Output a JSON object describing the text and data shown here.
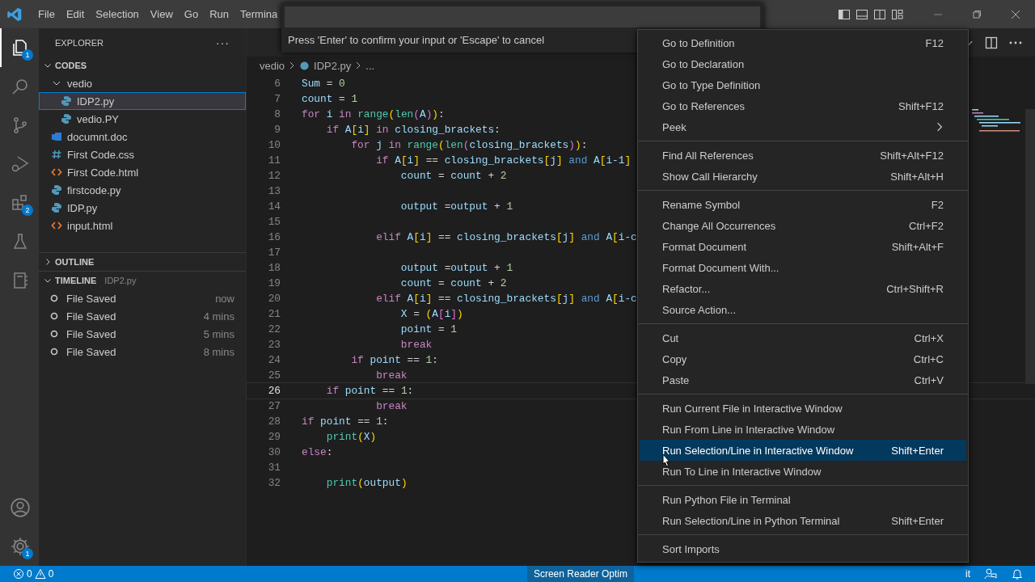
{
  "menu_bar": [
    "File",
    "Edit",
    "Selection",
    "View",
    "Go",
    "Run",
    "Termina"
  ],
  "activity_bar": [
    {
      "kind": "explorer",
      "badge": "1",
      "selected": true
    },
    {
      "kind": "search",
      "selected": false
    },
    {
      "kind": "source-control",
      "selected": false
    },
    {
      "kind": "run-debug",
      "selected": false
    },
    {
      "kind": "extensions",
      "badge": "2",
      "selected": false
    },
    {
      "kind": "testing",
      "selected": false
    },
    {
      "kind": "notebook",
      "selected": false
    }
  ],
  "activity_bottom": [
    {
      "kind": "account"
    },
    {
      "kind": "manage",
      "badge": "1"
    }
  ],
  "sidebar": {
    "title": "EXPLORER",
    "more": "···",
    "folder": "CODES",
    "tree": [
      {
        "name": "vedio",
        "kind": "folder",
        "expanded": true,
        "children": [
          {
            "name": "IDP2.py",
            "kind": "python",
            "selected": true
          },
          {
            "name": "vedio.PY",
            "kind": "python",
            "selected": false
          }
        ]
      },
      {
        "name": "documnt.doc",
        "kind": "doc",
        "selected": false
      },
      {
        "name": "First Code.css",
        "kind": "css",
        "selected": false
      },
      {
        "name": "First Code.html",
        "kind": "html",
        "selected": false
      },
      {
        "name": "firstcode.py",
        "kind": "python",
        "selected": false
      },
      {
        "name": "IDP.py",
        "kind": "python",
        "selected": false
      },
      {
        "name": "input.html",
        "kind": "html",
        "selected": false
      }
    ],
    "outline": {
      "title": "OUTLINE",
      "expanded": false
    },
    "timeline": {
      "title": "TIMELINE",
      "file": "IDP2.py",
      "expanded": true,
      "items": [
        {
          "label": "File Saved",
          "time": "now"
        },
        {
          "label": "File Saved",
          "time": "4 mins"
        },
        {
          "label": "File Saved",
          "time": "5 mins"
        },
        {
          "label": "File Saved",
          "time": "8 mins"
        }
      ]
    }
  },
  "command_palette": {
    "message": "Press 'Enter' to confirm your input or 'Escape' to cancel"
  },
  "breadcrumb": [
    "vedio",
    "IDP2.py",
    "..."
  ],
  "editor": {
    "lines": [
      {
        "n": "6",
        "current": false,
        "tokens": [
          {
            "text": "Sum",
            "kind": "var"
          },
          {
            "text": " = ",
            "kind": "op"
          },
          {
            "text": "0",
            "kind": "num"
          }
        ]
      },
      {
        "n": "7",
        "current": false,
        "tokens": [
          {
            "text": "count",
            "kind": "var"
          },
          {
            "text": " = ",
            "kind": "op"
          },
          {
            "text": "1",
            "kind": "num"
          }
        ]
      },
      {
        "n": "8",
        "current": false,
        "tokens": [
          {
            "text": "for ",
            "kind": "kw"
          },
          {
            "text": "i ",
            "kind": "var"
          },
          {
            "text": "in ",
            "kind": "kw"
          },
          {
            "text": "range",
            "kind": "fn"
          },
          {
            "text": "(",
            "kind": "b1"
          },
          {
            "text": "len",
            "kind": "fn"
          },
          {
            "text": "(",
            "kind": "b2"
          },
          {
            "text": "A",
            "kind": "var"
          },
          {
            "text": ")",
            "kind": "b2"
          },
          {
            "text": ")",
            "kind": "b1"
          },
          {
            "text": ":",
            "kind": "op"
          }
        ]
      },
      {
        "n": "9",
        "current": false,
        "tokens": [
          {
            "text": "    if ",
            "kind": "kw"
          },
          {
            "text": "A",
            "kind": "var"
          },
          {
            "text": "[",
            "kind": "b1"
          },
          {
            "text": "i",
            "kind": "var"
          },
          {
            "text": "]",
            "kind": "b1"
          },
          {
            "text": " in ",
            "kind": "kw"
          },
          {
            "text": "closing_brackets",
            "kind": "var"
          },
          {
            "text": ":",
            "kind": "op"
          }
        ]
      },
      {
        "n": "10",
        "current": false,
        "tokens": [
          {
            "text": "        for ",
            "kind": "kw"
          },
          {
            "text": "j ",
            "kind": "var"
          },
          {
            "text": "in ",
            "kind": "kw"
          },
          {
            "text": "range",
            "kind": "fn"
          },
          {
            "text": "(",
            "kind": "b1"
          },
          {
            "text": "len",
            "kind": "fn"
          },
          {
            "text": "(",
            "kind": "b2"
          },
          {
            "text": "closing_brackets",
            "kind": "var"
          },
          {
            "text": ")",
            "kind": "b2"
          },
          {
            "text": ")",
            "kind": "b1"
          },
          {
            "text": ":",
            "kind": "op"
          }
        ]
      },
      {
        "n": "11",
        "current": false,
        "tokens": [
          {
            "text": "            if ",
            "kind": "kw"
          },
          {
            "text": "A",
            "kind": "var"
          },
          {
            "text": "[",
            "kind": "b1"
          },
          {
            "text": "i",
            "kind": "var"
          },
          {
            "text": "]",
            "kind": "b1"
          },
          {
            "text": " == ",
            "kind": "op"
          },
          {
            "text": "closing_brackets",
            "kind": "var"
          },
          {
            "text": "[",
            "kind": "b1"
          },
          {
            "text": "j",
            "kind": "var"
          },
          {
            "text": "]",
            "kind": "b1"
          },
          {
            "text": " and ",
            "kind": "and"
          },
          {
            "text": "A",
            "kind": "var"
          },
          {
            "text": "[",
            "kind": "b1"
          },
          {
            "text": "i-1",
            "kind": "var"
          },
          {
            "text": "]",
            "kind": "b1"
          }
        ]
      },
      {
        "n": "12",
        "current": false,
        "tokens": [
          {
            "text": "                count",
            "kind": "var"
          },
          {
            "text": " = ",
            "kind": "op"
          },
          {
            "text": "count",
            "kind": "var"
          },
          {
            "text": " + ",
            "kind": "op"
          },
          {
            "text": "2",
            "kind": "num"
          }
        ]
      },
      {
        "n": "13",
        "current": false
      },
      {
        "n": "14",
        "current": false,
        "tokens": [
          {
            "text": "                output",
            "kind": "var"
          },
          {
            "text": " =",
            "kind": "op"
          },
          {
            "text": "output",
            "kind": "var"
          },
          {
            "text": " + ",
            "kind": "op"
          },
          {
            "text": "1",
            "kind": "num"
          }
        ]
      },
      {
        "n": "15",
        "current": false
      },
      {
        "n": "16",
        "current": false,
        "tokens": [
          {
            "text": "            elif ",
            "kind": "kw"
          },
          {
            "text": "A",
            "kind": "var"
          },
          {
            "text": "[",
            "kind": "b1"
          },
          {
            "text": "i",
            "kind": "var"
          },
          {
            "text": "]",
            "kind": "b1"
          },
          {
            "text": " == ",
            "kind": "op"
          },
          {
            "text": "closing_brackets",
            "kind": "var"
          },
          {
            "text": "[",
            "kind": "b1"
          },
          {
            "text": "j",
            "kind": "var"
          },
          {
            "text": "]",
            "kind": "b1"
          },
          {
            "text": " and ",
            "kind": "and"
          },
          {
            "text": "A",
            "kind": "var"
          },
          {
            "text": "[",
            "kind": "b1"
          },
          {
            "text": "i-c",
            "kind": "var"
          }
        ]
      },
      {
        "n": "17",
        "current": false
      },
      {
        "n": "18",
        "current": false,
        "tokens": [
          {
            "text": "                output",
            "kind": "var"
          },
          {
            "text": " =",
            "kind": "op"
          },
          {
            "text": "output",
            "kind": "var"
          },
          {
            "text": " + ",
            "kind": "op"
          },
          {
            "text": "1",
            "kind": "num"
          }
        ]
      },
      {
        "n": "19",
        "current": false,
        "tokens": [
          {
            "text": "                count",
            "kind": "var"
          },
          {
            "text": " = ",
            "kind": "op"
          },
          {
            "text": "count",
            "kind": "var"
          },
          {
            "text": " + ",
            "kind": "op"
          },
          {
            "text": "2",
            "kind": "num"
          }
        ]
      },
      {
        "n": "20",
        "current": false,
        "tokens": [
          {
            "text": "            elif ",
            "kind": "kw"
          },
          {
            "text": "A",
            "kind": "var"
          },
          {
            "text": "[",
            "kind": "b1"
          },
          {
            "text": "i",
            "kind": "var"
          },
          {
            "text": "]",
            "kind": "b1"
          },
          {
            "text": " == ",
            "kind": "op"
          },
          {
            "text": "closing_brackets",
            "kind": "var"
          },
          {
            "text": "[",
            "kind": "b1"
          },
          {
            "text": "j",
            "kind": "var"
          },
          {
            "text": "]",
            "kind": "b1"
          },
          {
            "text": " and ",
            "kind": "and"
          },
          {
            "text": "A",
            "kind": "var"
          },
          {
            "text": "[",
            "kind": "b1"
          },
          {
            "text": "i-c",
            "kind": "var"
          }
        ]
      },
      {
        "n": "21",
        "current": false,
        "tokens": [
          {
            "text": "                X",
            "kind": "var"
          },
          {
            "text": " = ",
            "kind": "op"
          },
          {
            "text": "(",
            "kind": "b1"
          },
          {
            "text": "A",
            "kind": "var"
          },
          {
            "text": "[",
            "kind": "b2"
          },
          {
            "text": "i",
            "kind": "var"
          },
          {
            "text": "]",
            "kind": "b2"
          },
          {
            "text": ")",
            "kind": "b1"
          }
        ]
      },
      {
        "n": "22",
        "current": false,
        "tokens": [
          {
            "text": "                point",
            "kind": "var"
          },
          {
            "text": " = ",
            "kind": "op"
          },
          {
            "text": "1",
            "kind": "num"
          }
        ]
      },
      {
        "n": "23",
        "current": false,
        "tokens": [
          {
            "text": "                break",
            "kind": "kw"
          }
        ]
      },
      {
        "n": "24",
        "current": false,
        "tokens": [
          {
            "text": "        if ",
            "kind": "kw"
          },
          {
            "text": "point",
            "kind": "var"
          },
          {
            "text": " == ",
            "kind": "op"
          },
          {
            "text": "1",
            "kind": "num"
          },
          {
            "text": ":",
            "kind": "op"
          }
        ]
      },
      {
        "n": "25",
        "current": false,
        "tokens": [
          {
            "text": "            break",
            "kind": "kw"
          }
        ]
      },
      {
        "n": "26",
        "current": true,
        "tokens": [
          {
            "text": "    if ",
            "kind": "kw"
          },
          {
            "text": "point",
            "kind": "var"
          },
          {
            "text": " == ",
            "kind": "op"
          },
          {
            "text": "1",
            "kind": "num"
          },
          {
            "text": ":",
            "kind": "op"
          }
        ]
      },
      {
        "n": "27",
        "current": false,
        "tokens": [
          {
            "text": "            break",
            "kind": "kw"
          }
        ]
      },
      {
        "n": "28",
        "current": false,
        "tokens": [
          {
            "text": "if ",
            "kind": "kw"
          },
          {
            "text": "point",
            "kind": "var"
          },
          {
            "text": " == ",
            "kind": "op"
          },
          {
            "text": "1",
            "kind": "num"
          },
          {
            "text": ":",
            "kind": "op"
          }
        ]
      },
      {
        "n": "29",
        "current": false,
        "tokens": [
          {
            "text": "    print",
            "kind": "fn"
          },
          {
            "text": "(",
            "kind": "b1"
          },
          {
            "text": "X",
            "kind": "var"
          },
          {
            "text": ")",
            "kind": "b1"
          }
        ]
      },
      {
        "n": "30",
        "current": false,
        "tokens": [
          {
            "text": "else",
            "kind": "kw"
          },
          {
            "text": ":",
            "kind": "op"
          }
        ]
      },
      {
        "n": "31",
        "current": false
      },
      {
        "n": "32",
        "current": false,
        "tokens": [
          {
            "text": "    print",
            "kind": "fn"
          },
          {
            "text": "(",
            "kind": "b1"
          },
          {
            "text": "output",
            "kind": "var"
          },
          {
            "text": ")",
            "kind": "b1"
          }
        ]
      }
    ]
  },
  "context_menu": [
    [
      {
        "label": "Go to Definition",
        "shortcut": "F12",
        "selected": false
      },
      {
        "label": "Go to Declaration",
        "selected": false
      },
      {
        "label": "Go to Type Definition",
        "selected": false
      },
      {
        "label": "Go to References",
        "shortcut": "Shift+F12",
        "selected": false
      },
      {
        "label": "Peek",
        "submenu": true,
        "selected": false
      }
    ],
    [
      {
        "label": "Find All References",
        "shortcut": "Shift+Alt+F12",
        "selected": false
      },
      {
        "label": "Show Call Hierarchy",
        "shortcut": "Shift+Alt+H",
        "selected": false
      }
    ],
    [
      {
        "label": "Rename Symbol",
        "shortcut": "F2",
        "selected": false
      },
      {
        "label": "Change All Occurrences",
        "shortcut": "Ctrl+F2",
        "selected": false
      },
      {
        "label": "Format Document",
        "shortcut": "Shift+Alt+F",
        "selected": false
      },
      {
        "label": "Format Document With...",
        "selected": false
      },
      {
        "label": "Refactor...",
        "shortcut": "Ctrl+Shift+R",
        "selected": false
      },
      {
        "label": "Source Action...",
        "selected": false
      }
    ],
    [
      {
        "label": "Cut",
        "shortcut": "Ctrl+X",
        "selected": false
      },
      {
        "label": "Copy",
        "shortcut": "Ctrl+C",
        "selected": false
      },
      {
        "label": "Paste",
        "shortcut": "Ctrl+V",
        "selected": false
      }
    ],
    [
      {
        "label": "Run Current File in Interactive Window",
        "selected": false
      },
      {
        "label": "Run From Line in Interactive Window",
        "selected": false
      },
      {
        "label": "Run Selection/Line in Interactive Window",
        "shortcut": "Shift+Enter",
        "selected": true
      },
      {
        "label": "Run To Line in Interactive Window",
        "selected": false
      }
    ],
    [
      {
        "label": "Run Python File in Terminal",
        "selected": false
      },
      {
        "label": "Run Selection/Line in Python Terminal",
        "shortcut": "Shift+Enter",
        "selected": false
      }
    ],
    [
      {
        "label": "Sort Imports",
        "selected": false
      }
    ]
  ],
  "status_bar": {
    "errors": "0",
    "warnings": "0",
    "screen_reader": "Screen Reader Optim",
    "right_text": "it"
  }
}
